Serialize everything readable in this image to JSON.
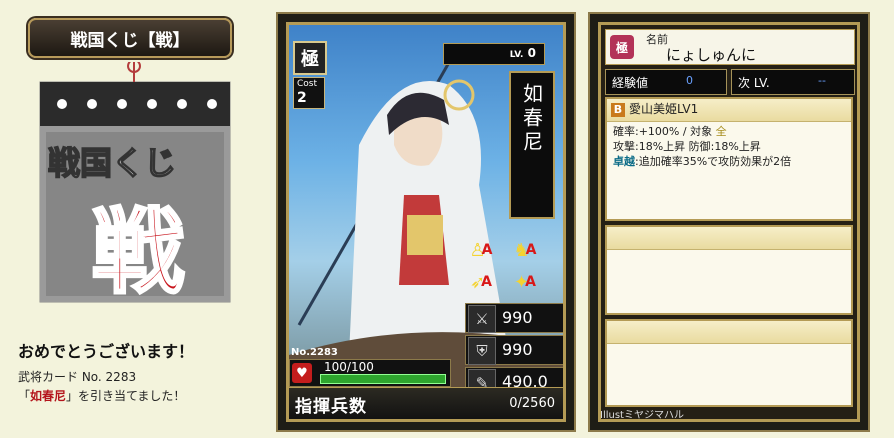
{
  "banner": {
    "title": "戦国くじ【戦】"
  },
  "calendar": {
    "logo_text": "戦国くじ",
    "big_char": "戦"
  },
  "result": {
    "congrats": "おめでとうございます！",
    "card_label": "武将カード No. 2283",
    "open_quote": "「",
    "card_name": "如春尼",
    "close_text": "」を引き当てました！"
  },
  "card": {
    "rarity": "極",
    "cost_label": "Cost",
    "cost_value": "2",
    "lv_label": "LV.",
    "lv_value": "0",
    "name": "如春尼",
    "skills": [
      {
        "icon": "spear-icon",
        "glyph": "♙",
        "grade": "A"
      },
      {
        "icon": "horse-icon",
        "glyph": "♞",
        "grade": "A"
      },
      {
        "icon": "bow-icon",
        "glyph": "➶",
        "grade": "A"
      },
      {
        "icon": "cannon-icon",
        "glyph": "✦",
        "grade": "A"
      }
    ],
    "stats": [
      {
        "name": "attack",
        "icon": "sword-icon",
        "glyph": "⚔",
        "value": "990"
      },
      {
        "name": "defense",
        "icon": "helmet-icon",
        "glyph": "⛨",
        "value": "990"
      },
      {
        "name": "strategy",
        "icon": "scroll-icon",
        "glyph": "✎",
        "value": "490.0"
      }
    ],
    "number": "No.2283",
    "hp_text": "100/100",
    "hp_fill": 1.0,
    "command_label": "指揮兵数",
    "command_value": "0/2560",
    "illust": "Illustミヤジマハル"
  },
  "panel": {
    "name_label": "名前",
    "name_value": "にょしゅんに",
    "name_icon": "極",
    "exp_label": "経験値",
    "exp_value": "0",
    "next_label": "次 LV.",
    "next_value": "--",
    "skill_grade": "B",
    "skill_name": "愛山美姫LV1",
    "skill_line1_a": "確率:+100% / 対象 ",
    "skill_line1_b": "全",
    "skill_line2": "攻撃:18%上昇 防御:18%上昇",
    "skill_line3_a": "卓越",
    "skill_line3_b": ":追加確率35%で攻防効果が2倍"
  }
}
